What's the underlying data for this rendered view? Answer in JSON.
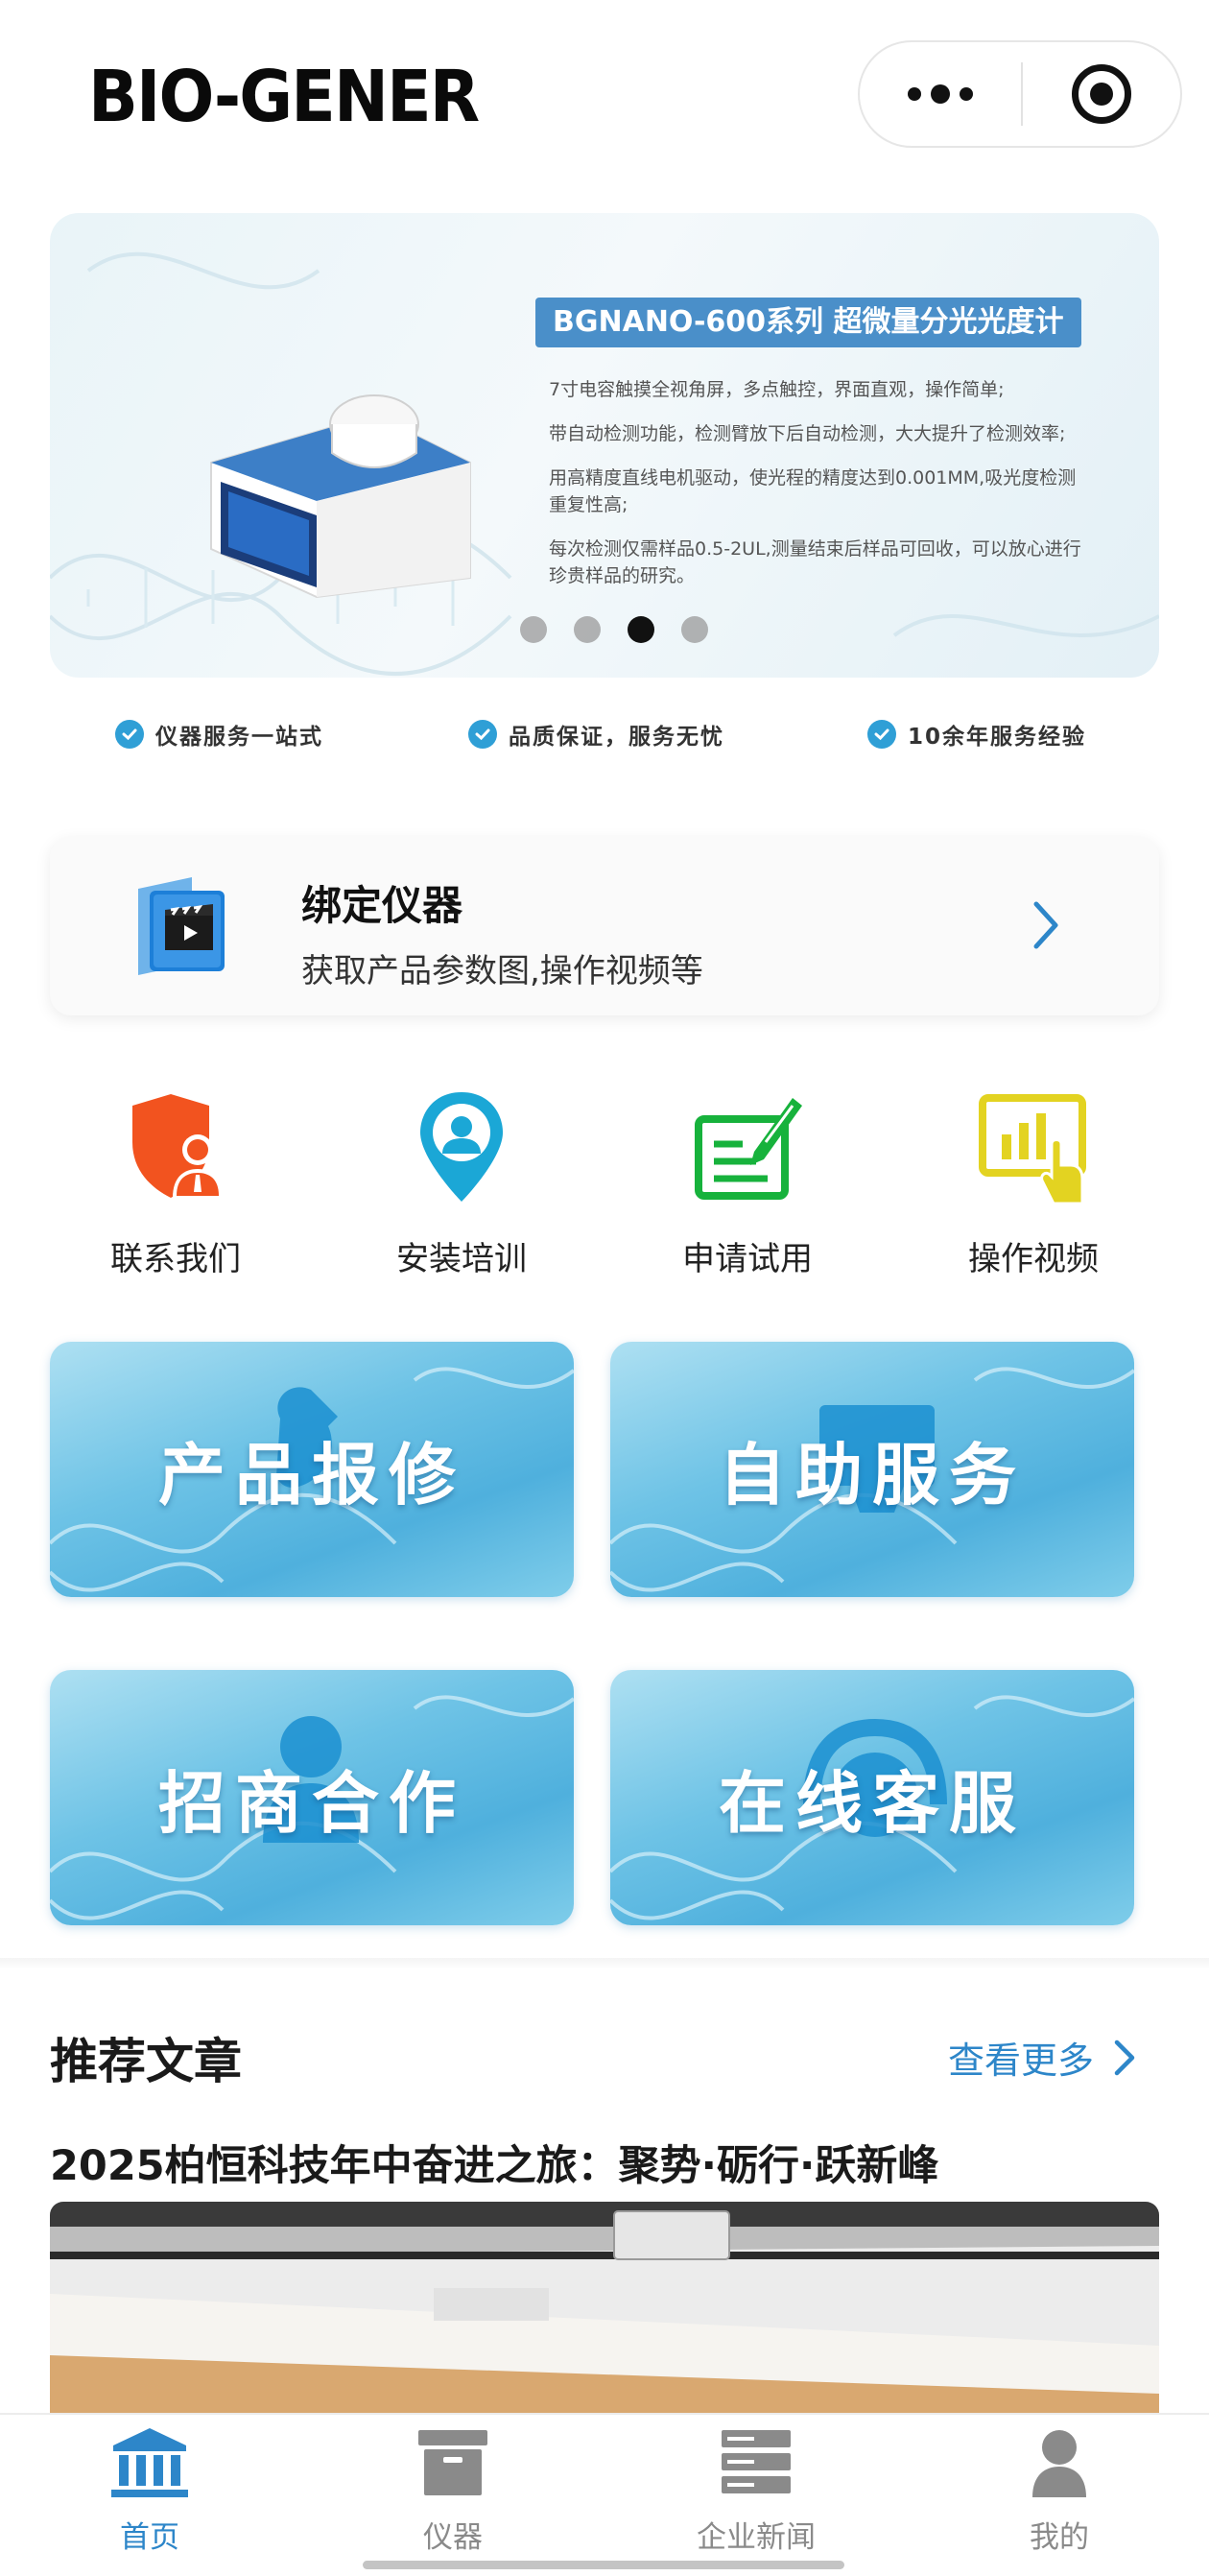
{
  "header": {
    "logo_text": "BIO-GENER",
    "capsule_icons": [
      "more-dots-icon",
      "target-close-icon"
    ]
  },
  "banner": {
    "title": "BGNANO-600系列 超微量分光光度计",
    "lines": [
      "7寸电容触摸全视角屏，多点触控，界面直观，操作简单;",
      "带自动检测功能，检测臂放下后自动检测，大大提升了检测效率;",
      "用高精度直线电机驱动，使光程的精度达到0.001MM,吸光度检测重复性高;",
      "每次检测仅需样品0.5-2UL,测量结束后样品可回收，可以放心进行珍贵样品的研究。"
    ],
    "pager": {
      "count": 4,
      "active_index": 2
    }
  },
  "features": [
    {
      "label": "仪器服务一站式",
      "icon": "check-circle-icon"
    },
    {
      "label": "品质保证，服务无忧",
      "icon": "check-circle-icon"
    },
    {
      "label": "10余年服务经验",
      "icon": "check-circle-icon"
    }
  ],
  "bind_card": {
    "title": "绑定仪器",
    "subtitle": "获取产品参数图,操作视频等",
    "icon": "video-folder-icon",
    "arrow_icon": "chevron-right-icon"
  },
  "quick_actions": [
    {
      "label": "联系我们",
      "icon": "shield-person-icon",
      "color": "#f2531f"
    },
    {
      "label": "安装培训",
      "icon": "location-person-icon",
      "color": "#1ba7d6"
    },
    {
      "label": "申请试用",
      "icon": "form-pen-icon",
      "color": "#17b23c"
    },
    {
      "label": "操作视频",
      "icon": "chart-touch-icon",
      "color": "#e3d321"
    }
  ],
  "service_tiles": [
    {
      "label": "产品报修",
      "icon": "wrench-icon"
    },
    {
      "label": "自助服务",
      "icon": "monitor-icon"
    },
    {
      "label": "招商合作",
      "icon": "person-icon"
    },
    {
      "label": "在线客服",
      "icon": "headset-icon"
    }
  ],
  "articles": {
    "section_title": "推荐文章",
    "see_more": "查看更多",
    "items": [
      {
        "title": "2025柏恒科技年中奋进之旅：聚势·砺行·跃新峰"
      }
    ]
  },
  "tabbar": {
    "items": [
      {
        "label": "首页",
        "icon": "bank-home-icon",
        "active": true
      },
      {
        "label": "仪器",
        "icon": "box-icon",
        "active": false
      },
      {
        "label": "企业新闻",
        "icon": "server-stack-icon",
        "active": false
      },
      {
        "label": "我的",
        "icon": "user-icon",
        "active": false
      }
    ],
    "active_color": "#2d86c9",
    "inactive_color": "#8a8a8a"
  }
}
